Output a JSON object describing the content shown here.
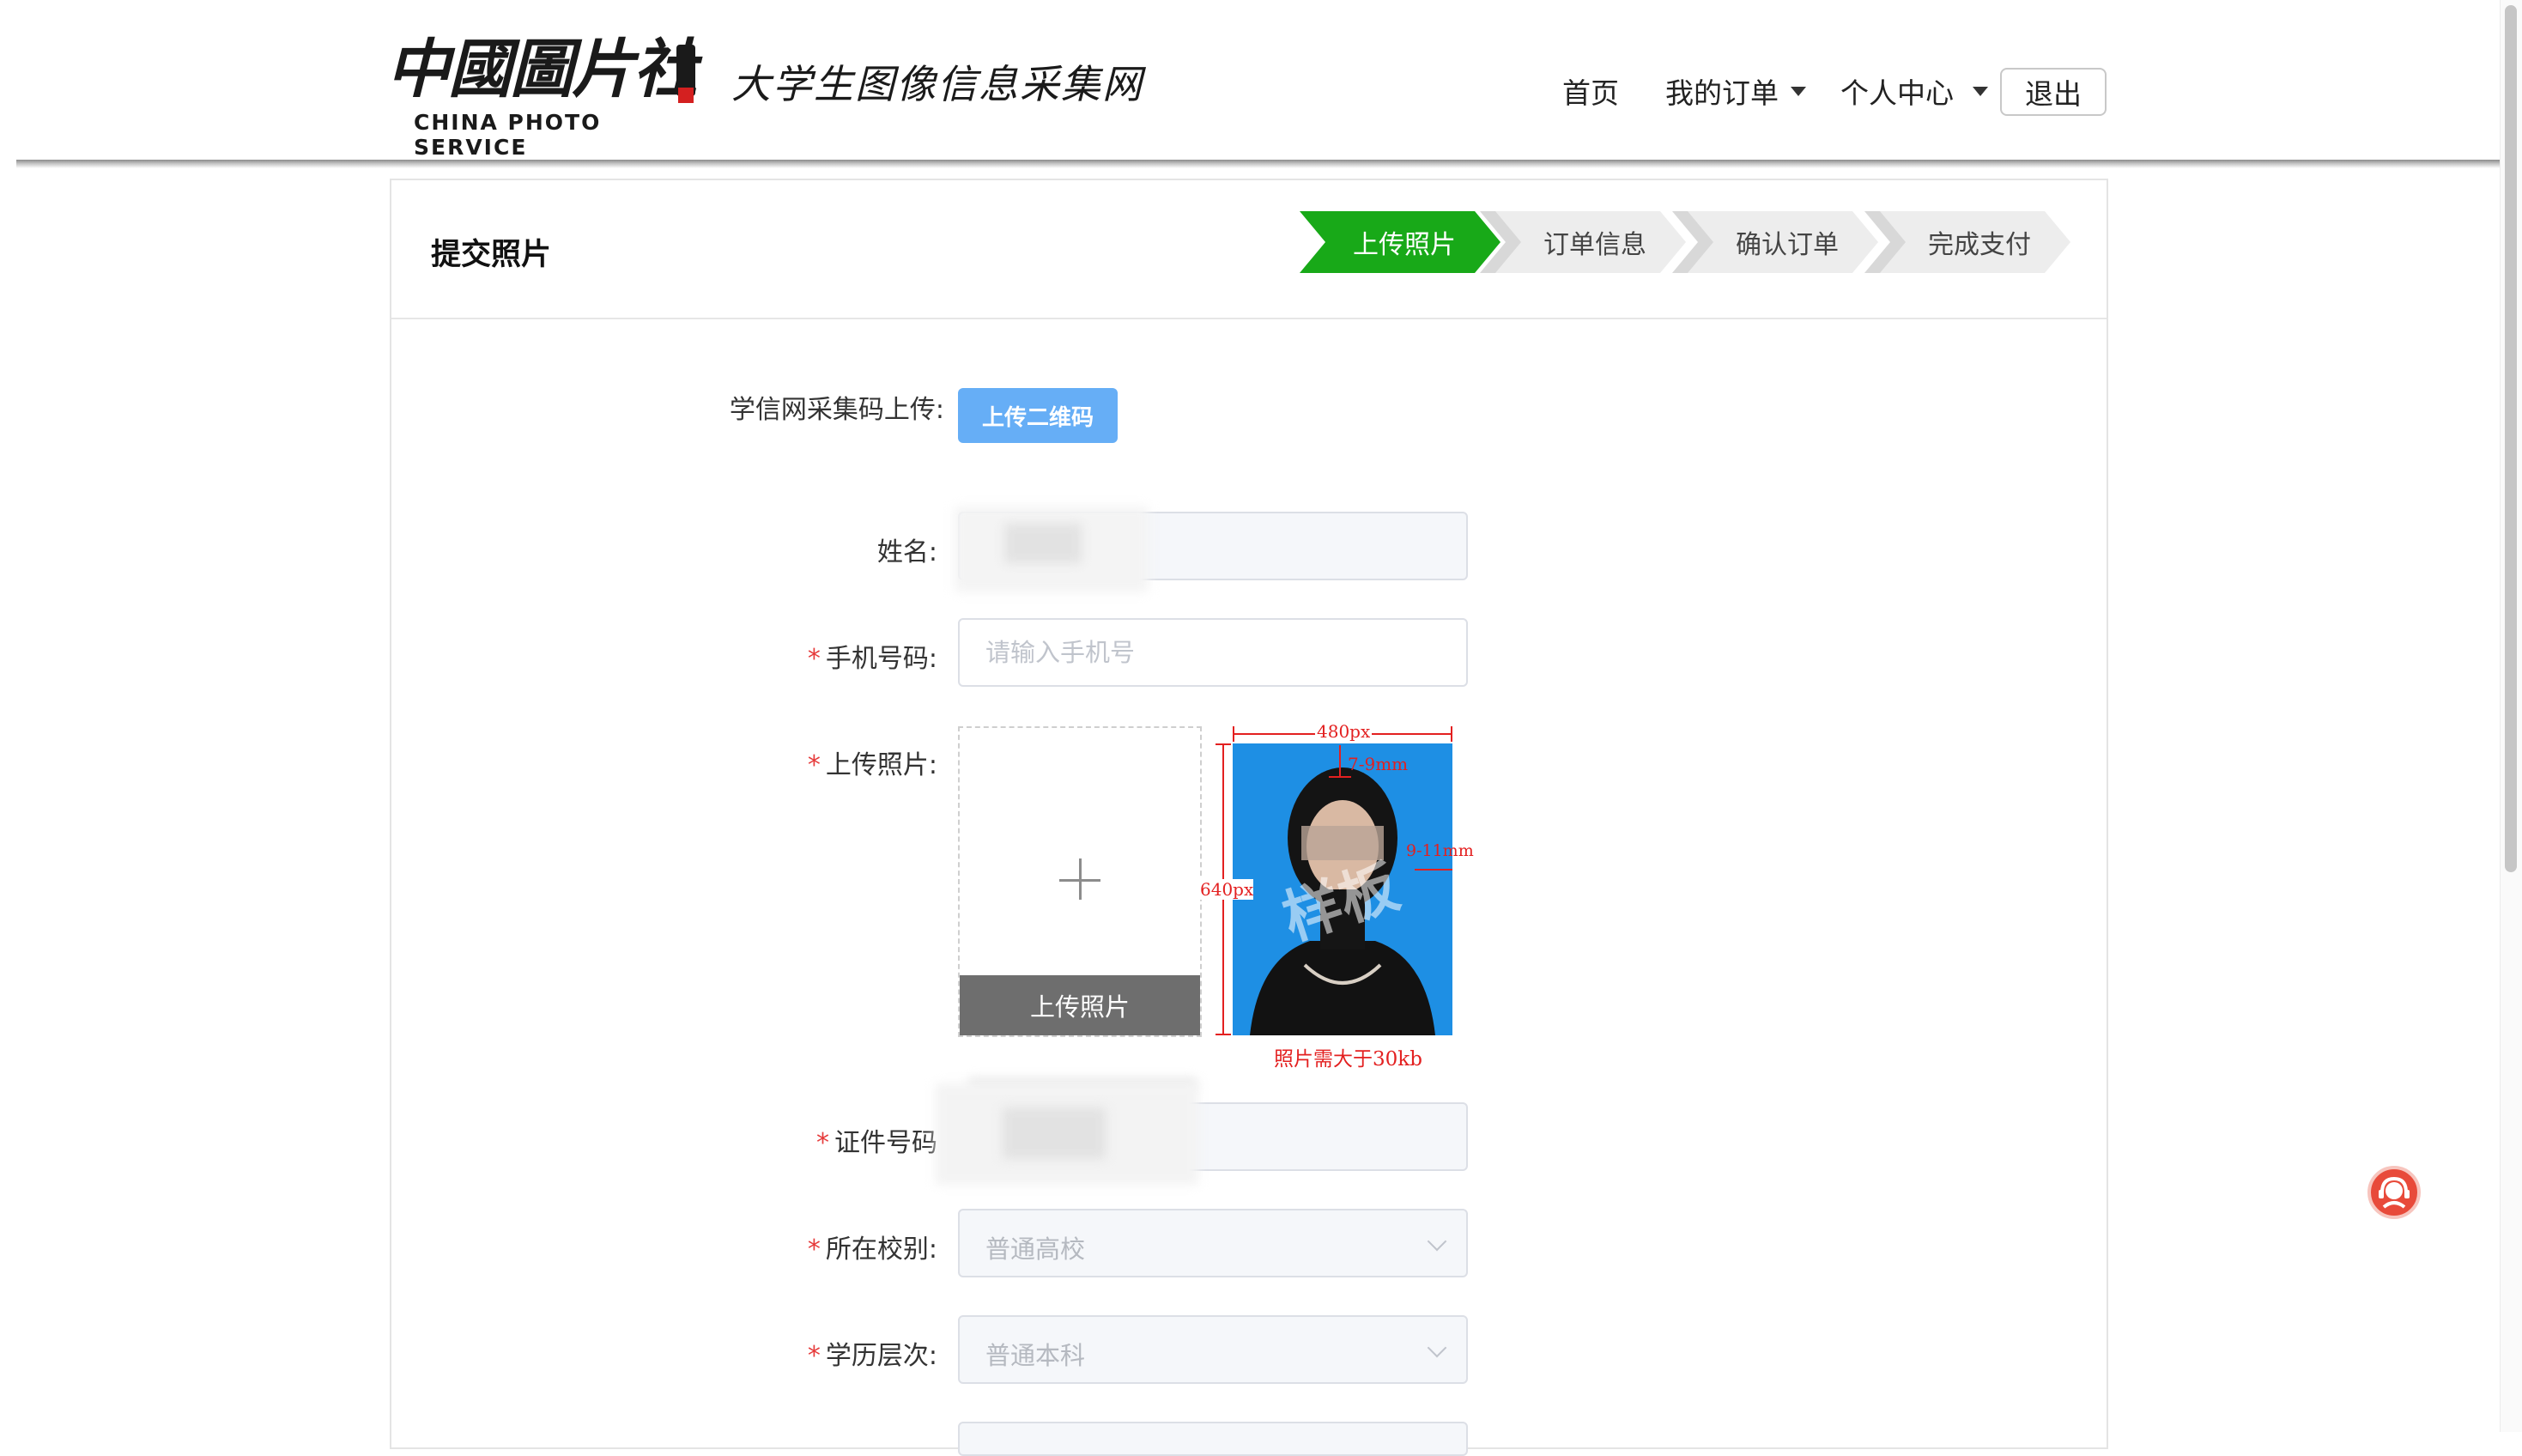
{
  "header": {
    "logo_cn": "中國圖片社",
    "logo_en": "CHINA PHOTO SERVICE",
    "site_name": "大学生图像信息采集网",
    "nav": {
      "home": "首页",
      "my_orders": "我的订单",
      "user_center": "个人中心",
      "logout": "退出"
    }
  },
  "page": {
    "title": "提交照片",
    "steps": [
      "上传照片",
      "订单信息",
      "确认订单",
      "完成支付"
    ],
    "active_step": 0
  },
  "form": {
    "qr_label": "学信网采集码上传:",
    "qr_button": "上传二维码",
    "name_label": "姓名:",
    "phone_label": "手机号码:",
    "phone_placeholder": "请输入手机号",
    "photo_label": "上传照片:",
    "photo_upload_label": "上传照片",
    "id_label": "证件号码",
    "school_type_label": "所在校别:",
    "school_type_value": "普通高校",
    "degree_label": "学历层次:",
    "degree_value": "普通本科",
    "required_mark": "*"
  },
  "sample_photo": {
    "width_label": "480px",
    "height_label": "640px",
    "top_margin_label": "7-9mm",
    "side_margin_label": "9-11mm",
    "watermark": "样板",
    "size_note": "照片需大于30kb"
  },
  "colors": {
    "step_active": "#18a918",
    "step_inactive": "#ededed",
    "qr_button": "#66aef6",
    "required": "#e63b3b",
    "sample_bg": "#1e8fe4",
    "annotation": "#e32020"
  },
  "icons": {
    "caret": "caret-down-icon",
    "plus": "plus-icon",
    "support": "customer-service-icon",
    "select_arrow": "chevron-down-icon"
  }
}
